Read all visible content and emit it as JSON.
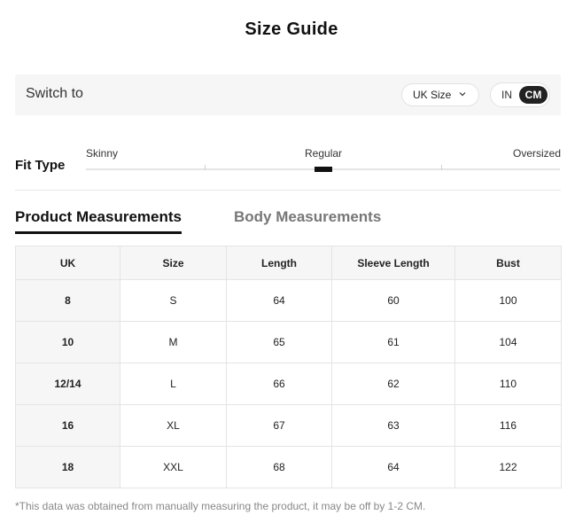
{
  "title": "Size Guide",
  "switch": {
    "label": "Switch to",
    "size_system": "UK Size",
    "unit_in": "IN",
    "unit_cm": "CM",
    "selected_unit": "CM"
  },
  "fit": {
    "label": "Fit Type",
    "options": [
      "Skinny",
      "Regular",
      "Oversized"
    ],
    "selected": "Regular"
  },
  "tabs": {
    "product": "Product Measurements",
    "body": "Body Measurements",
    "active": "Product Measurements"
  },
  "table": {
    "headers": [
      "UK",
      "Size",
      "Length",
      "Sleeve Length",
      "Bust"
    ],
    "rows": [
      [
        "8",
        "S",
        "64",
        "60",
        "100"
      ],
      [
        "10",
        "M",
        "65",
        "61",
        "104"
      ],
      [
        "12/14",
        "L",
        "66",
        "62",
        "110"
      ],
      [
        "16",
        "XL",
        "67",
        "63",
        "116"
      ],
      [
        "18",
        "XXL",
        "68",
        "64",
        "122"
      ]
    ]
  },
  "footnote": "*This data was obtained from manually measuring the product, it may be off by 1-2 CM.",
  "colors": {
    "accent": "#111111",
    "panel_bg": "#f6f6f6",
    "border": "#e4e4e4",
    "muted_text": "#888888"
  },
  "icons": {
    "size_dropdown": "chevron-down-icon"
  }
}
